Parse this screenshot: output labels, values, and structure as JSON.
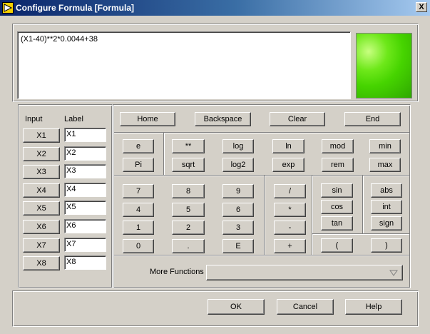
{
  "window": {
    "title": "Configure Formula [Formula]",
    "close_label": "X"
  },
  "formula": {
    "expression": "(X1-40)**2*0.0044+38",
    "indicator_color": "#46d400"
  },
  "inputs": {
    "input_header": "Input",
    "label_header": "Label",
    "rows": [
      {
        "button": "X1",
        "label": "X1"
      },
      {
        "button": "X2",
        "label": "X2"
      },
      {
        "button": "X3",
        "label": "X3"
      },
      {
        "button": "X4",
        "label": "X4"
      },
      {
        "button": "X5",
        "label": "X5"
      },
      {
        "button": "X6",
        "label": "X6"
      },
      {
        "button": "X7",
        "label": "X7"
      },
      {
        "button": "X8",
        "label": "X8"
      }
    ]
  },
  "editing": {
    "home": "Home",
    "backspace": "Backspace",
    "clear": "Clear",
    "end": "End"
  },
  "constants": {
    "e": "e",
    "pi": "Pi"
  },
  "functions": {
    "power": "**",
    "log": "log",
    "ln": "ln",
    "mod": "mod",
    "min": "min",
    "sqrt": "sqrt",
    "log2": "log2",
    "exp": "exp",
    "rem": "rem",
    "max": "max"
  },
  "keypad": {
    "seven": "7",
    "eight": "8",
    "nine": "9",
    "four": "4",
    "five": "5",
    "six": "6",
    "one": "1",
    "two": "2",
    "three": "3",
    "zero": "0",
    "decimal": ".",
    "exponent": "E"
  },
  "operators": {
    "divide": "/",
    "multiply": "*",
    "subtract": "-",
    "add": "+"
  },
  "trig": {
    "sin": "sin",
    "cos": "cos",
    "tan": "tan"
  },
  "misc_functions": {
    "abs": "abs",
    "int": "int",
    "sign": "sign"
  },
  "parens": {
    "open": "(",
    "close": ")"
  },
  "more_functions": {
    "label": "More Functions",
    "selected": ""
  },
  "dialog": {
    "ok": "OK",
    "cancel": "Cancel",
    "help": "Help"
  }
}
